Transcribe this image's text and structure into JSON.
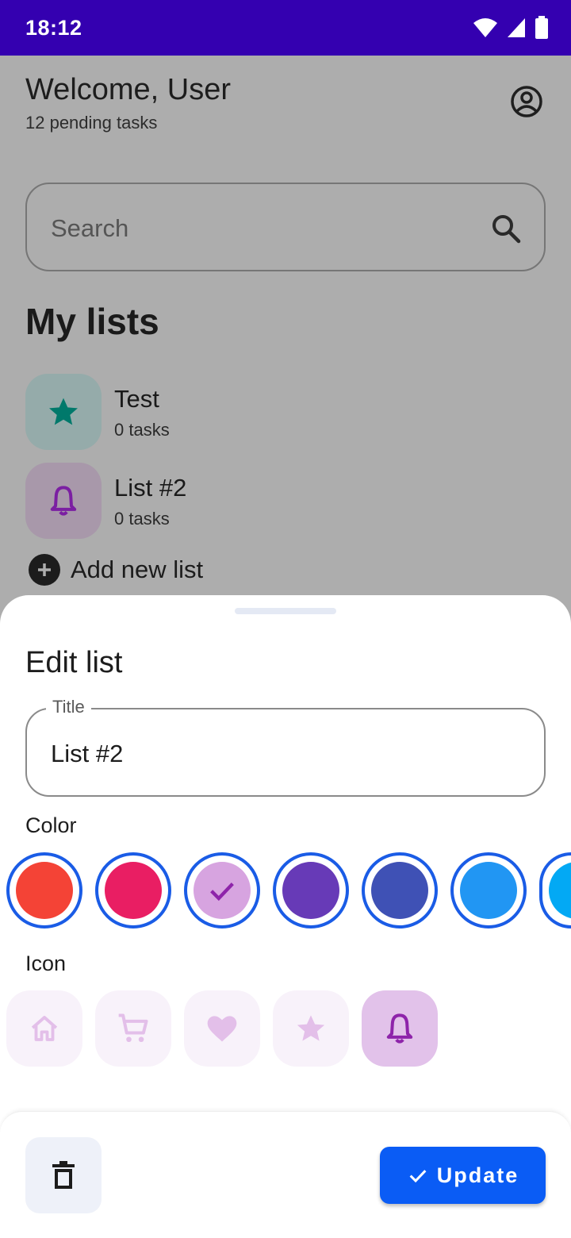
{
  "status_bar": {
    "time": "18:12",
    "icons": [
      "wifi-icon",
      "signal-icon",
      "battery-icon"
    ]
  },
  "header": {
    "title": "Welcome, User",
    "subtitle": "12 pending tasks",
    "account_icon": "account-circle-icon"
  },
  "search": {
    "placeholder": "Search",
    "icon": "search-icon"
  },
  "lists_section": {
    "title": "My lists",
    "items": [
      {
        "name": "Test",
        "count": "0 tasks",
        "icon": "star-icon",
        "color": "#00796b"
      },
      {
        "name": "List #2",
        "count": "0 tasks",
        "icon": "bell-icon",
        "color": "#8e24aa"
      }
    ],
    "add_label": "Add new list"
  },
  "sheet": {
    "title": "Edit list",
    "title_field": {
      "label": "Title",
      "value": "List #2"
    },
    "color_label": "Color",
    "colors": [
      "#f44336",
      "#e91e63",
      "#ce93d8",
      "#673ab7",
      "#3f51b5",
      "#2196f3",
      "#03a9f4"
    ],
    "selected_color": "#ce93d8",
    "icon_label": "Icon",
    "icons": [
      "home-icon",
      "cart-icon",
      "heart-icon",
      "star-icon",
      "bell-icon"
    ],
    "selected_icon": "bell-icon"
  },
  "actions": {
    "delete_icon": "trash-icon",
    "update_label": "Update",
    "update_color": "#0a5cf5"
  }
}
